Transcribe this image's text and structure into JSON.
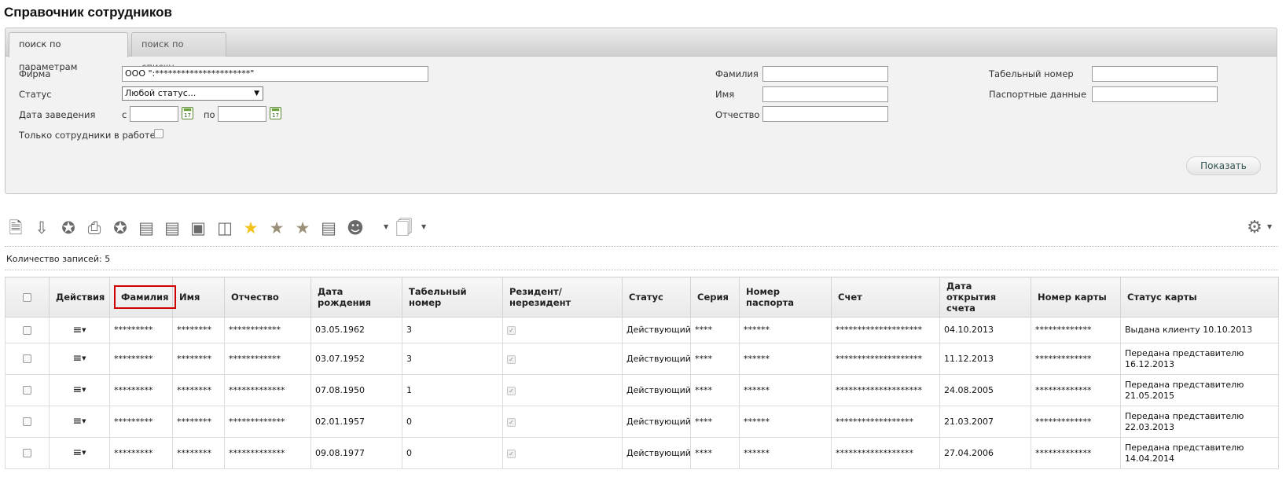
{
  "page": {
    "title": "Справочник сотрудников"
  },
  "tabs": [
    {
      "label": "поиск по параметрам",
      "active": true
    },
    {
      "label": "поиск по списку",
      "active": false
    }
  ],
  "filters": {
    "firm_label": "Фирма",
    "firm_value": "ООО \":**********************\"",
    "status_label": "Статус",
    "status_value": "Любой статус...",
    "date_label": "Дата заведения",
    "date_from_label": "с",
    "date_to_label": "по",
    "date_from_value": "",
    "date_to_value": "",
    "calendar_day": "17",
    "only_active_label": "Только сотрудники в работе",
    "surname_label": "Фамилия",
    "name_label": "Имя",
    "patronymic_label": "Отчество",
    "tab_number_label": "Табельный номер",
    "passport_label": "Паспортные данные",
    "show_button": "Показать"
  },
  "toolbar": {
    "icons": [
      "new-document-icon",
      "download-icon",
      "award-icon",
      "print-check-icon",
      "award-check-icon",
      "id-card-icon",
      "id-card-edit-icon",
      "id-card-delete-icon",
      "cards-stack-icon",
      "star-icon",
      "star-add-icon",
      "star-gray-icon",
      "document-card-icon",
      "users-menu-icon",
      "document-menu-icon"
    ],
    "settings_icon": "gear-icon"
  },
  "records_count": "Количество записей: 5",
  "table": {
    "headers": [
      "",
      "Действия",
      "Фамилия",
      "Имя",
      "Отчество",
      "Дата рождения",
      "Табельный номер",
      "Резидент/ нерезидент",
      "Статус",
      "Серия",
      "Номер паспорта",
      "Счет",
      "Дата открытия счета",
      "Номер карты",
      "Статус карты"
    ],
    "rows": [
      {
        "surname": "*********",
        "name": "********",
        "patronymic": "************",
        "birth": "03.05.1962",
        "tab": "3",
        "status": "Действующий",
        "series": "****",
        "passport": "******",
        "account": "********************",
        "opened": "04.10.2013",
        "card": "*************",
        "card_status": "Выдана клиенту 10.10.2013"
      },
      {
        "surname": "*********",
        "name": "********",
        "patronymic": "************",
        "birth": "03.07.1952",
        "tab": "3",
        "status": "Действующий",
        "series": "****",
        "passport": "******",
        "account": "********************",
        "opened": "11.12.2013",
        "card": "*************",
        "card_status": "Передана представителю 16.12.2013"
      },
      {
        "surname": "*********",
        "name": "********",
        "patronymic": "*************",
        "birth": "07.08.1950",
        "tab": "1",
        "status": "Действующий",
        "series": "****",
        "passport": "******",
        "account": "********************",
        "opened": "24.08.2005",
        "card": "*************",
        "card_status": "Передана представителю 21.05.2015"
      },
      {
        "surname": "*********",
        "name": "********",
        "patronymic": "*************",
        "birth": "02.01.1957",
        "tab": "0",
        "status": "Действующий",
        "series": "****",
        "passport": "******",
        "account": "******************",
        "opened": "21.03.2007",
        "card": "*************",
        "card_status": "Передана представителю 22.03.2013"
      },
      {
        "surname": "*********",
        "name": "********",
        "patronymic": "*************",
        "birth": "09.08.1977",
        "tab": "0",
        "status": "Действующий",
        "series": "****",
        "passport": "******",
        "account": "******************",
        "opened": "27.04.2006",
        "card": "*************",
        "card_status": "Передана представителю 14.04.2014"
      }
    ]
  },
  "colors": {
    "highlight": "#d10000",
    "star": "#f2c21b"
  }
}
